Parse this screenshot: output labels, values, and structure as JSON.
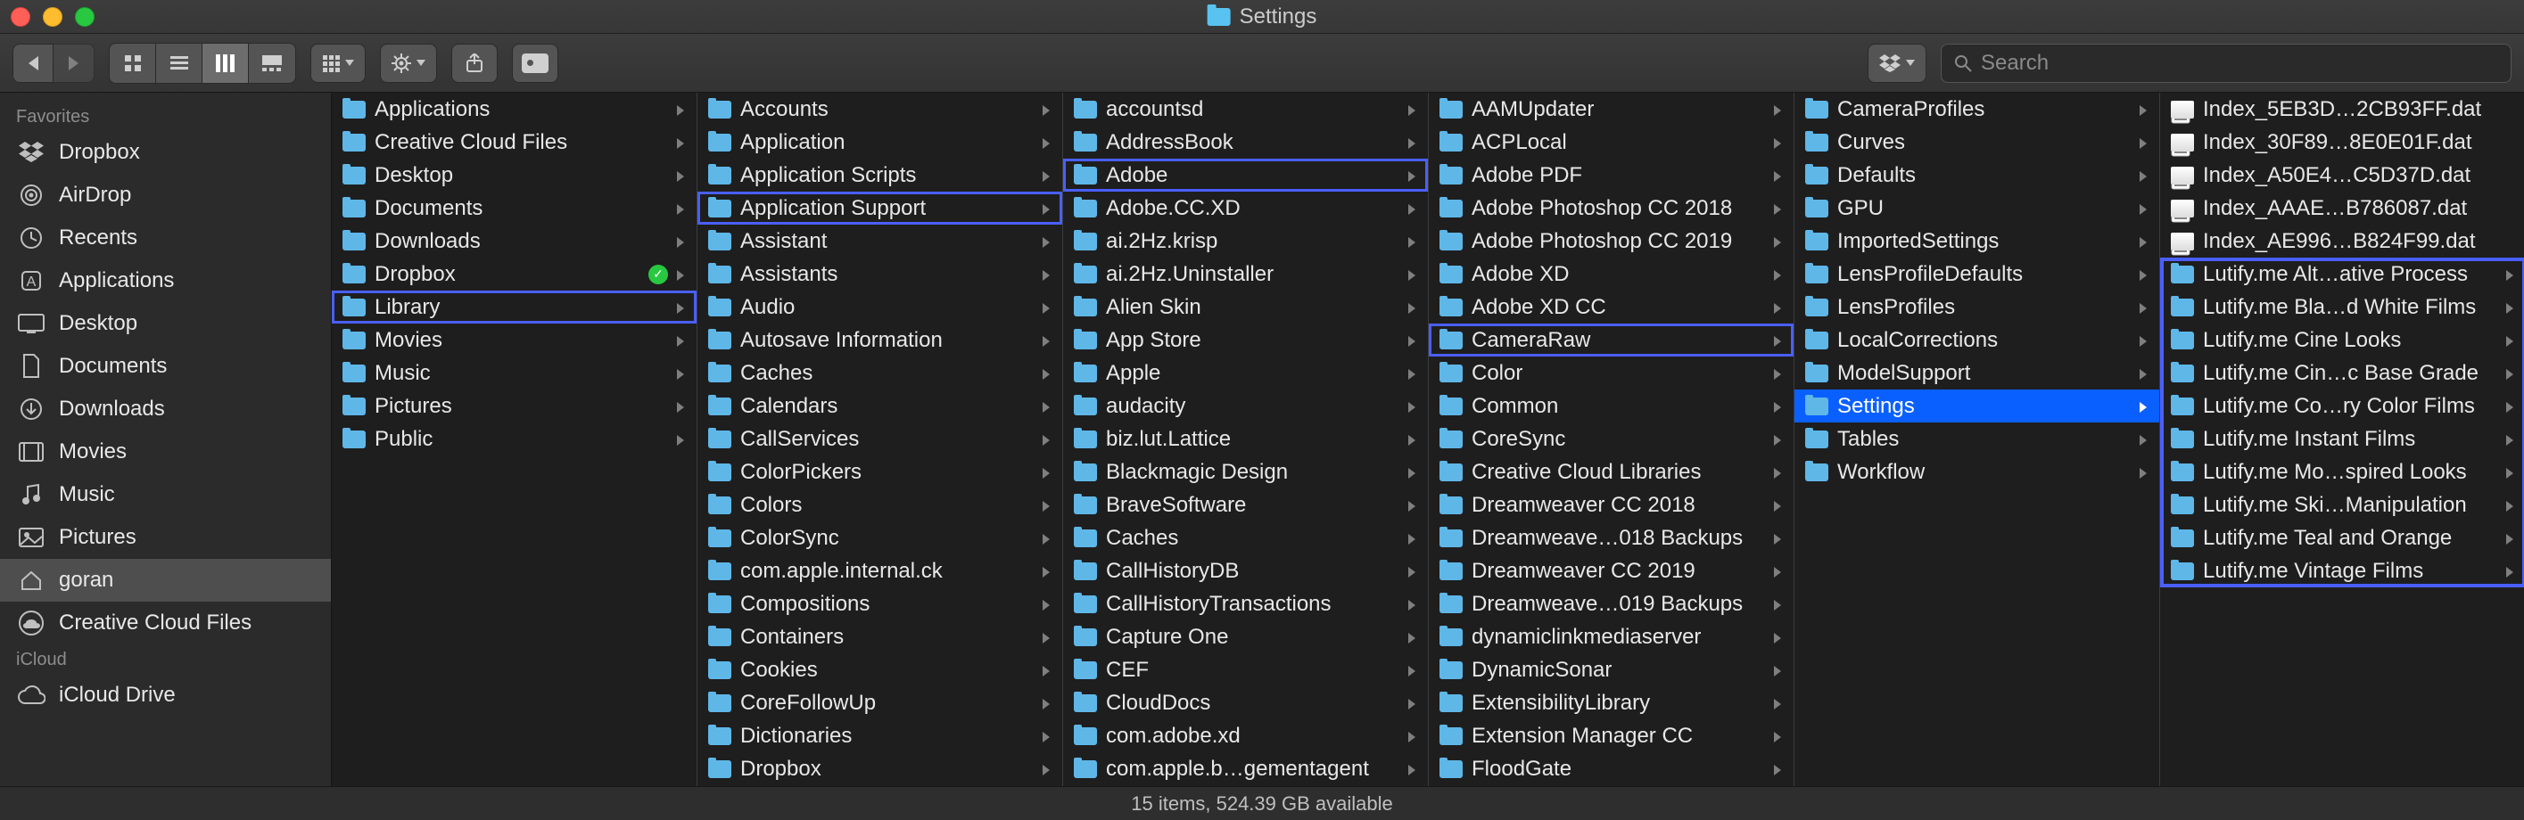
{
  "window": {
    "title": "Settings"
  },
  "search": {
    "placeholder": "Search"
  },
  "sidebar": {
    "sections": [
      {
        "header": "Favorites",
        "items": [
          {
            "label": "Dropbox",
            "icon": "dropbox-icon",
            "selected": false
          },
          {
            "label": "AirDrop",
            "icon": "airdrop-icon",
            "selected": false
          },
          {
            "label": "Recents",
            "icon": "recents-icon",
            "selected": false
          },
          {
            "label": "Applications",
            "icon": "applications-icon",
            "selected": false
          },
          {
            "label": "Desktop",
            "icon": "desktop-icon",
            "selected": false
          },
          {
            "label": "Documents",
            "icon": "documents-icon",
            "selected": false
          },
          {
            "label": "Downloads",
            "icon": "downloads-icon",
            "selected": false
          },
          {
            "label": "Movies",
            "icon": "movies-icon",
            "selected": false
          },
          {
            "label": "Music",
            "icon": "music-icon",
            "selected": false
          },
          {
            "label": "Pictures",
            "icon": "pictures-icon",
            "selected": false
          },
          {
            "label": "goran",
            "icon": "home-icon",
            "selected": true
          },
          {
            "label": "Creative Cloud Files",
            "icon": "cc-icon",
            "selected": false
          }
        ]
      },
      {
        "header": "iCloud",
        "items": [
          {
            "label": "iCloud Drive",
            "icon": "icloud-icon",
            "selected": false
          }
        ]
      }
    ]
  },
  "columns": [
    {
      "items": [
        {
          "label": "Applications",
          "type": "folder",
          "arrow": true
        },
        {
          "label": "Creative Cloud Files",
          "type": "folder",
          "arrow": true
        },
        {
          "label": "Desktop",
          "type": "folder",
          "arrow": true
        },
        {
          "label": "Documents",
          "type": "folder",
          "arrow": true
        },
        {
          "label": "Downloads",
          "type": "folder",
          "arrow": true
        },
        {
          "label": "Dropbox",
          "type": "folder",
          "arrow": true,
          "badge": "ok"
        },
        {
          "label": "Library",
          "type": "folder",
          "arrow": true,
          "highlighted": true
        },
        {
          "label": "Movies",
          "type": "folder",
          "arrow": true
        },
        {
          "label": "Music",
          "type": "folder",
          "arrow": true
        },
        {
          "label": "Pictures",
          "type": "folder",
          "arrow": true
        },
        {
          "label": "Public",
          "type": "folder",
          "arrow": true
        }
      ]
    },
    {
      "items": [
        {
          "label": "Accounts",
          "type": "folder",
          "arrow": true
        },
        {
          "label": "Application",
          "type": "folder",
          "arrow": true
        },
        {
          "label": "Application Scripts",
          "type": "folder",
          "arrow": true
        },
        {
          "label": "Application Support",
          "type": "folder",
          "arrow": true,
          "highlighted": true
        },
        {
          "label": "Assistant",
          "type": "folder",
          "arrow": true
        },
        {
          "label": "Assistants",
          "type": "folder",
          "arrow": true
        },
        {
          "label": "Audio",
          "type": "folder",
          "arrow": true
        },
        {
          "label": "Autosave Information",
          "type": "folder",
          "arrow": true
        },
        {
          "label": "Caches",
          "type": "folder",
          "arrow": true
        },
        {
          "label": "Calendars",
          "type": "folder",
          "arrow": true
        },
        {
          "label": "CallServices",
          "type": "folder",
          "arrow": true
        },
        {
          "label": "ColorPickers",
          "type": "folder",
          "arrow": true
        },
        {
          "label": "Colors",
          "type": "folder",
          "arrow": true
        },
        {
          "label": "ColorSync",
          "type": "folder",
          "arrow": true
        },
        {
          "label": "com.apple.internal.ck",
          "type": "folder",
          "arrow": true
        },
        {
          "label": "Compositions",
          "type": "folder",
          "arrow": true
        },
        {
          "label": "Containers",
          "type": "folder",
          "arrow": true
        },
        {
          "label": "Cookies",
          "type": "folder",
          "arrow": true
        },
        {
          "label": "CoreFollowUp",
          "type": "folder",
          "arrow": true
        },
        {
          "label": "Dictionaries",
          "type": "folder",
          "arrow": true
        },
        {
          "label": "Dropbox",
          "type": "folder",
          "arrow": true
        }
      ]
    },
    {
      "items": [
        {
          "label": "accountsd",
          "type": "folder",
          "arrow": true
        },
        {
          "label": "AddressBook",
          "type": "folder",
          "arrow": true
        },
        {
          "label": "Adobe",
          "type": "folder",
          "arrow": true,
          "highlighted": true
        },
        {
          "label": "Adobe.CC.XD",
          "type": "folder",
          "arrow": true
        },
        {
          "label": "ai.2Hz.krisp",
          "type": "folder",
          "arrow": true
        },
        {
          "label": "ai.2Hz.Uninstaller",
          "type": "folder",
          "arrow": true
        },
        {
          "label": "Alien Skin",
          "type": "folder",
          "arrow": true
        },
        {
          "label": "App Store",
          "type": "folder",
          "arrow": true
        },
        {
          "label": "Apple",
          "type": "folder",
          "arrow": true
        },
        {
          "label": "audacity",
          "type": "folder",
          "arrow": true
        },
        {
          "label": "biz.lut.Lattice",
          "type": "folder",
          "arrow": true
        },
        {
          "label": "Blackmagic Design",
          "type": "folder",
          "arrow": true
        },
        {
          "label": "BraveSoftware",
          "type": "folder",
          "arrow": true
        },
        {
          "label": "Caches",
          "type": "folder",
          "arrow": true
        },
        {
          "label": "CallHistoryDB",
          "type": "folder",
          "arrow": true
        },
        {
          "label": "CallHistoryTransactions",
          "type": "folder",
          "arrow": true
        },
        {
          "label": "Capture One",
          "type": "folder",
          "arrow": true
        },
        {
          "label": "CEF",
          "type": "folder",
          "arrow": true
        },
        {
          "label": "CloudDocs",
          "type": "folder",
          "arrow": true
        },
        {
          "label": "com.adobe.xd",
          "type": "folder",
          "arrow": true
        },
        {
          "label": "com.apple.b…gementagent",
          "type": "folder",
          "arrow": true
        }
      ]
    },
    {
      "items": [
        {
          "label": "AAMUpdater",
          "type": "folder",
          "arrow": true
        },
        {
          "label": "ACPLocal",
          "type": "folder",
          "arrow": true
        },
        {
          "label": "Adobe PDF",
          "type": "folder",
          "arrow": true
        },
        {
          "label": "Adobe Photoshop CC 2018",
          "type": "folder",
          "arrow": true
        },
        {
          "label": "Adobe Photoshop CC 2019",
          "type": "folder",
          "arrow": true
        },
        {
          "label": "Adobe XD",
          "type": "folder",
          "arrow": true
        },
        {
          "label": "Adobe XD CC",
          "type": "folder",
          "arrow": true
        },
        {
          "label": "CameraRaw",
          "type": "folder",
          "arrow": true,
          "highlighted": true
        },
        {
          "label": "Color",
          "type": "folder",
          "arrow": true
        },
        {
          "label": "Common",
          "type": "folder",
          "arrow": true
        },
        {
          "label": "CoreSync",
          "type": "folder",
          "arrow": true
        },
        {
          "label": "Creative Cloud Libraries",
          "type": "folder",
          "arrow": true
        },
        {
          "label": "Dreamweaver CC 2018",
          "type": "folder",
          "arrow": true
        },
        {
          "label": "Dreamweave…018 Backups",
          "type": "folder",
          "arrow": true
        },
        {
          "label": "Dreamweaver CC 2019",
          "type": "folder",
          "arrow": true
        },
        {
          "label": "Dreamweave…019 Backups",
          "type": "folder",
          "arrow": true
        },
        {
          "label": "dynamiclinkmediaserver",
          "type": "folder",
          "arrow": true
        },
        {
          "label": "DynamicSonar",
          "type": "folder",
          "arrow": true
        },
        {
          "label": "ExtensibilityLibrary",
          "type": "folder",
          "arrow": true
        },
        {
          "label": "Extension Manager CC",
          "type": "folder",
          "arrow": true
        },
        {
          "label": "FloodGate",
          "type": "folder",
          "arrow": true
        }
      ]
    },
    {
      "items": [
        {
          "label": "CameraProfiles",
          "type": "folder",
          "arrow": true
        },
        {
          "label": "Curves",
          "type": "folder",
          "arrow": true
        },
        {
          "label": "Defaults",
          "type": "folder",
          "arrow": true
        },
        {
          "label": "GPU",
          "type": "folder",
          "arrow": true
        },
        {
          "label": "ImportedSettings",
          "type": "folder",
          "arrow": true
        },
        {
          "label": "LensProfileDefaults",
          "type": "folder",
          "arrow": true
        },
        {
          "label": "LensProfiles",
          "type": "folder",
          "arrow": true
        },
        {
          "label": "LocalCorrections",
          "type": "folder",
          "arrow": true
        },
        {
          "label": "ModelSupport",
          "type": "folder",
          "arrow": true
        },
        {
          "label": "Settings",
          "type": "folder",
          "arrow": true,
          "selected": true
        },
        {
          "label": "Tables",
          "type": "folder",
          "arrow": true
        },
        {
          "label": "Workflow",
          "type": "folder",
          "arrow": true
        }
      ]
    },
    {
      "highlightBox": true,
      "items": [
        {
          "label": "Index_5EB3D…2CB93FF.dat",
          "type": "file",
          "arrow": false
        },
        {
          "label": "Index_30F89…8E0E01F.dat",
          "type": "file",
          "arrow": false
        },
        {
          "label": "Index_A50E4…C5D37D.dat",
          "type": "file",
          "arrow": false
        },
        {
          "label": "Index_AAAE…B786087.dat",
          "type": "file",
          "arrow": false
        },
        {
          "label": "Index_AE996…B824F99.dat",
          "type": "file",
          "arrow": false
        },
        {
          "label": "Lutify.me Alt…ative Process",
          "type": "folder",
          "arrow": true
        },
        {
          "label": "Lutify.me Bla…d White Films",
          "type": "folder",
          "arrow": true
        },
        {
          "label": "Lutify.me Cine Looks",
          "type": "folder",
          "arrow": true
        },
        {
          "label": "Lutify.me Cin…c Base Grade",
          "type": "folder",
          "arrow": true
        },
        {
          "label": "Lutify.me Co…ry Color Films",
          "type": "folder",
          "arrow": true
        },
        {
          "label": "Lutify.me Instant Films",
          "type": "folder",
          "arrow": true
        },
        {
          "label": "Lutify.me Mo…spired Looks",
          "type": "folder",
          "arrow": true
        },
        {
          "label": "Lutify.me Ski…Manipulation",
          "type": "folder",
          "arrow": true
        },
        {
          "label": "Lutify.me Teal and Orange",
          "type": "folder",
          "arrow": true
        },
        {
          "label": "Lutify.me Vintage Films",
          "type": "folder",
          "arrow": true
        }
      ]
    }
  ],
  "status": {
    "text": "15 items, 524.39 GB available"
  }
}
